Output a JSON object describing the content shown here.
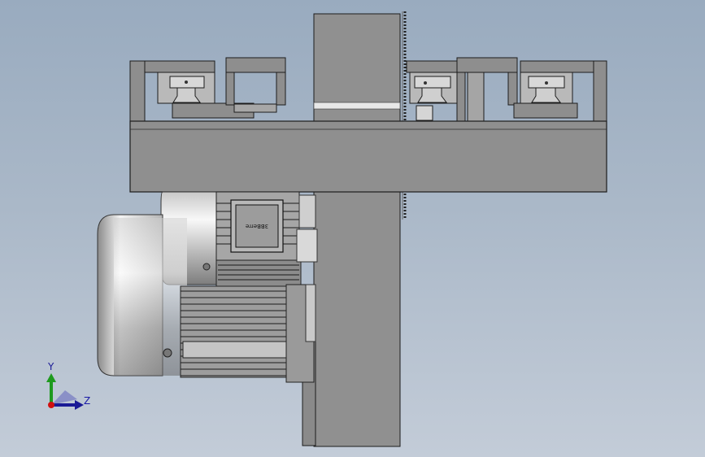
{
  "viewport": {
    "background_top": "#99abbf",
    "background_bottom": "#c3ccd8",
    "model_color": "#8f8f8f",
    "edge_color": "#1c1c1c"
  },
  "model": {
    "parts": [
      "base-plate",
      "vertical-column",
      "rail-brackets",
      "linear-guides",
      "blower-motor",
      "chain"
    ],
    "nameplate_text": "3BBerre"
  },
  "triad": {
    "y_label": "Y",
    "z_label": "Z",
    "y_color": "#1e9a1e",
    "z_color": "#1a1aa6",
    "origin_color": "#d01010"
  }
}
